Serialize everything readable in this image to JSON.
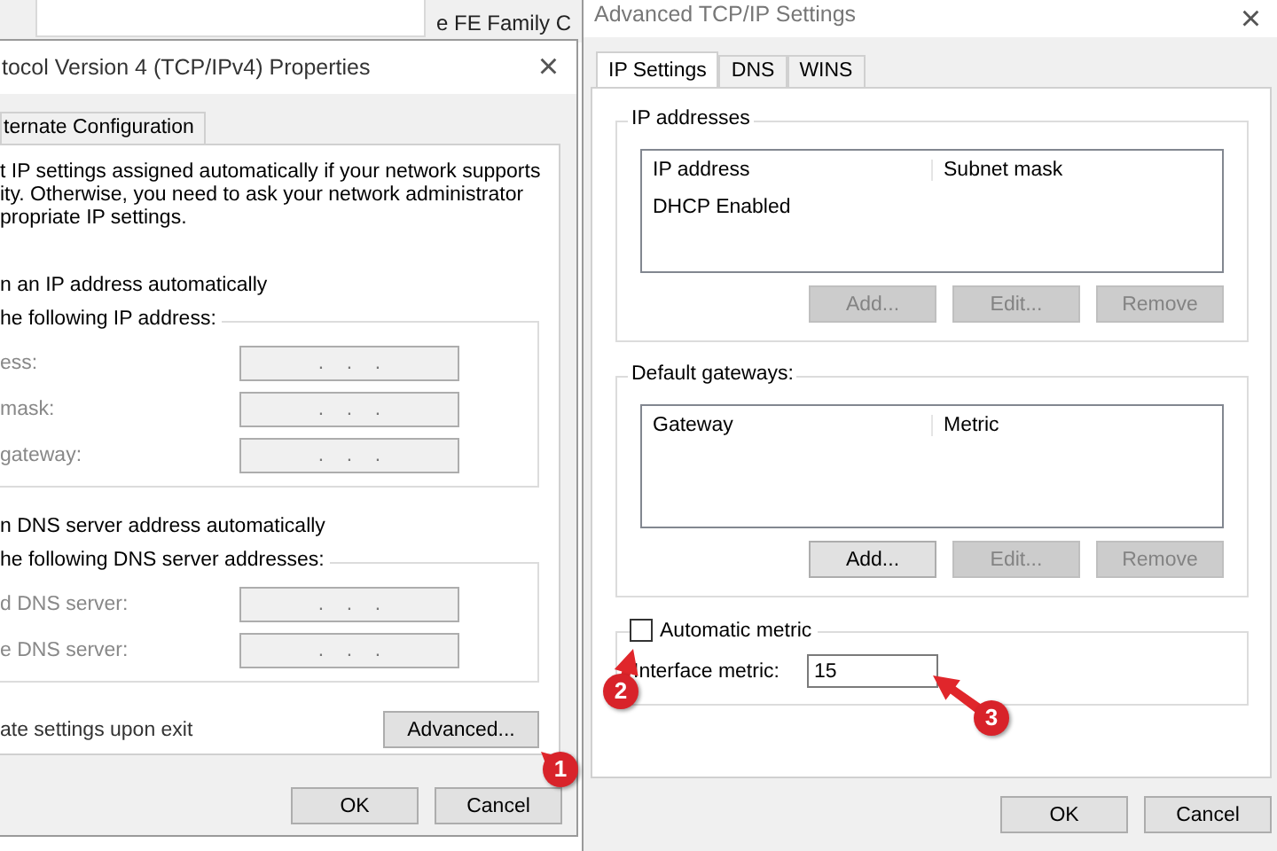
{
  "background_window": {
    "text": "e FE Family C"
  },
  "ipv4_dialog": {
    "title": "tocol Version 4 (TCP/IPv4) Properties",
    "close": "×",
    "tabs": [
      {
        "label": "ternate Configuration",
        "selected": false
      }
    ],
    "intro": "t IP settings assigned automatically if your network supports\nity. Otherwise, you need to ask your network administrator\npropriate IP settings.",
    "ip_auto_option": "n an IP address automatically",
    "ip_group": {
      "legend": "he following IP address:",
      "fields": [
        {
          "label": "ess:",
          "value": ".    .    ."
        },
        {
          "label": "mask:",
          "value": ".    .    ."
        },
        {
          "label": "gateway:",
          "value": ".    .    ."
        }
      ]
    },
    "dns_auto_option": "n DNS server address automatically",
    "dns_group": {
      "legend": "he following DNS server addresses:",
      "fields": [
        {
          "label": "d DNS server:",
          "value": ".    .    ."
        },
        {
          "label": "e DNS server:",
          "value": ".    .    ."
        }
      ]
    },
    "validate_option": "ate settings upon exit",
    "advanced_button": "Advanced...",
    "buttons": [
      {
        "label": "OK",
        "disabled": false
      },
      {
        "label": "Cancel",
        "disabled": false
      }
    ]
  },
  "advanced_dialog": {
    "title": "Advanced TCP/IP Settings",
    "close": "×",
    "tabs": [
      {
        "label": "IP Settings",
        "selected": true
      },
      {
        "label": "DNS",
        "selected": false
      },
      {
        "label": "WINS",
        "selected": false
      }
    ],
    "groups": [
      {
        "legend": "IP addresses",
        "columns": [
          "IP address",
          "Subnet mask"
        ],
        "rows": [
          [
            "DHCP Enabled"
          ]
        ],
        "buttons": [
          {
            "label": "Add...",
            "disabled": true
          },
          {
            "label": "Edit...",
            "disabled": true
          },
          {
            "label": "Remove",
            "disabled": true
          }
        ]
      },
      {
        "legend": "Default gateways:",
        "columns": [
          "Gateway",
          "Metric"
        ],
        "buttons": [
          {
            "label": "Add...",
            "disabled": false
          },
          {
            "label": "Edit...",
            "disabled": true
          },
          {
            "label": "Remove",
            "disabled": true
          }
        ]
      }
    ],
    "automatic_metric": {
      "label": "Automatic metric",
      "checked": false
    },
    "interface_metric": {
      "label": "Interface metric:",
      "value": "15"
    },
    "buttons": [
      {
        "label": "OK",
        "disabled": false
      },
      {
        "label": "Cancel",
        "disabled": false
      }
    ]
  },
  "callouts": [
    {
      "number": "1"
    },
    {
      "number": "2"
    },
    {
      "number": "3"
    }
  ]
}
